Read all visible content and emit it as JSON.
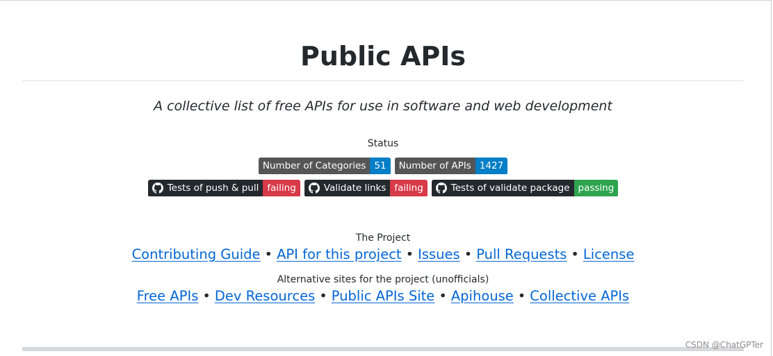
{
  "header": {
    "title": "Public APIs",
    "subtitle": "A collective list of free APIs for use in software and web development"
  },
  "status": {
    "label": "Status",
    "count_badges": [
      {
        "label": "Number of Categories",
        "value": "51",
        "value_color": "#007ec6"
      },
      {
        "label": "Number of APIs",
        "value": "1427",
        "value_color": "#007ec6"
      }
    ],
    "workflow_badges": [
      {
        "label": "Tests of push & pull",
        "value": "failing",
        "value_color": "#d73a49",
        "icon": "github-icon"
      },
      {
        "label": "Validate links",
        "value": "failing",
        "value_color": "#d73a49",
        "icon": "github-icon"
      },
      {
        "label": "Tests of validate package",
        "value": "passing",
        "value_color": "#2ea44f",
        "icon": "github-icon"
      }
    ]
  },
  "project": {
    "label": "The Project",
    "links": [
      "Contributing Guide",
      "API for this project",
      "Issues",
      "Pull Requests",
      "License"
    ]
  },
  "alternatives": {
    "label": "Alternative sites for the project (unofficials)",
    "links": [
      "Free APIs",
      "Dev Resources",
      "Public APIs Site",
      "Apihouse",
      "Collective APIs"
    ]
  },
  "separator": "•",
  "watermark": "CSDN @ChatGPTer",
  "colors": {
    "link": "#0366d6",
    "text": "#24292e",
    "badge_label": "#555555",
    "github_badge_label": "#24292e"
  }
}
